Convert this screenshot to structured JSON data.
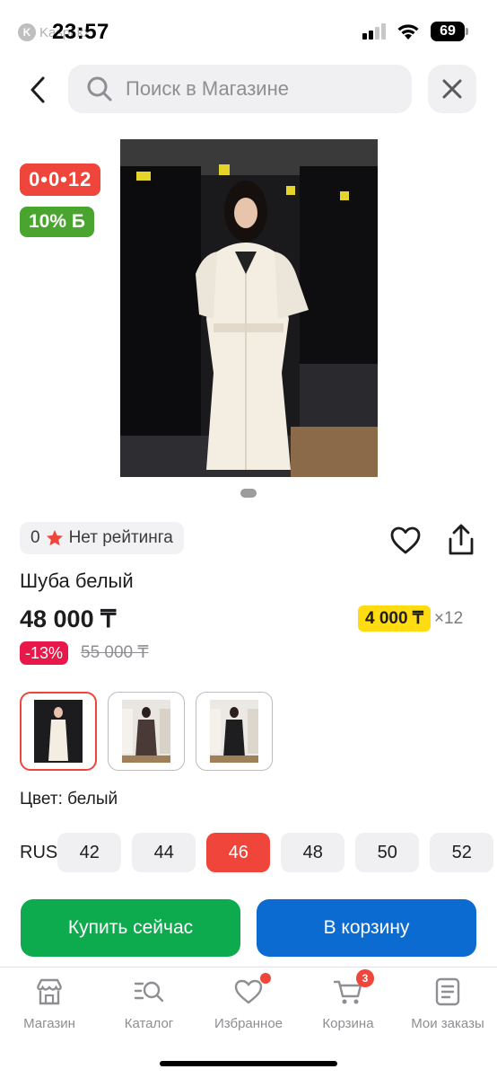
{
  "status_bar": {
    "back_app": "Kaspi.kz",
    "time": "23:57",
    "battery": "69"
  },
  "header": {
    "search_placeholder": "Поиск в Магазине"
  },
  "badges": {
    "installment_timer": "0•0•12",
    "bonus": "10% Б"
  },
  "rating": {
    "count": "0",
    "label": "Нет рейтинга"
  },
  "product": {
    "title": "Шуба белый",
    "price": "48 000 ₸",
    "installment_amount": "4 000 ₸",
    "installment_months": "×12",
    "discount": "-13%",
    "old_price": "55 000 ₸",
    "color_label": "Цвет: белый"
  },
  "sizes": {
    "system": "RUS",
    "options": [
      "42",
      "44",
      "46",
      "48",
      "50",
      "52"
    ],
    "selected": "46"
  },
  "actions": {
    "buy_now": "Купить сейчас",
    "add_to_cart": "В корзину"
  },
  "tabbar": {
    "items": [
      {
        "label": "Магазин",
        "icon": "store-icon"
      },
      {
        "label": "Каталог",
        "icon": "catalog-icon"
      },
      {
        "label": "Избранное",
        "icon": "heart-icon"
      },
      {
        "label": "Корзина",
        "icon": "cart-icon",
        "badge": "3"
      },
      {
        "label": "Мои заказы",
        "icon": "orders-icon"
      }
    ]
  },
  "colors": {
    "accent_red": "#f0453a",
    "green": "#0eaa4e",
    "blue": "#0c6bd0",
    "yellow": "#ffdb11"
  }
}
